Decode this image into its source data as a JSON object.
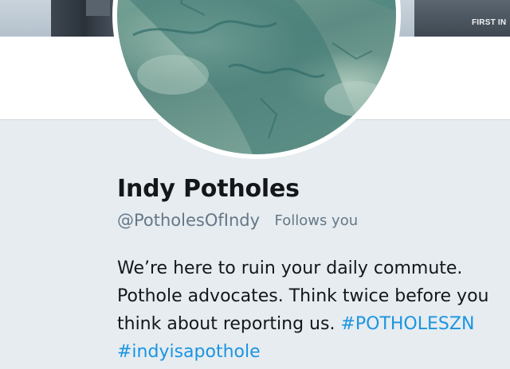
{
  "banner": {
    "building_sign": "FIRST IN"
  },
  "profile": {
    "name": "Indy Potholes",
    "handle": "@PotholesOfIndy",
    "follows_badge": "Follows you",
    "bio": {
      "line1": "We’re here to ruin your daily commute.",
      "line2": "Pothole advocates. Think twice before you",
      "line3_text": "think about reporting us.",
      "hashtag1": "#POTHOLESZN",
      "hashtag2": "#indyisapothole"
    }
  },
  "colors": {
    "page_background": "#e6ecf0",
    "text_primary": "#14171a",
    "text_secondary": "#657786",
    "link": "#1b95e0"
  }
}
